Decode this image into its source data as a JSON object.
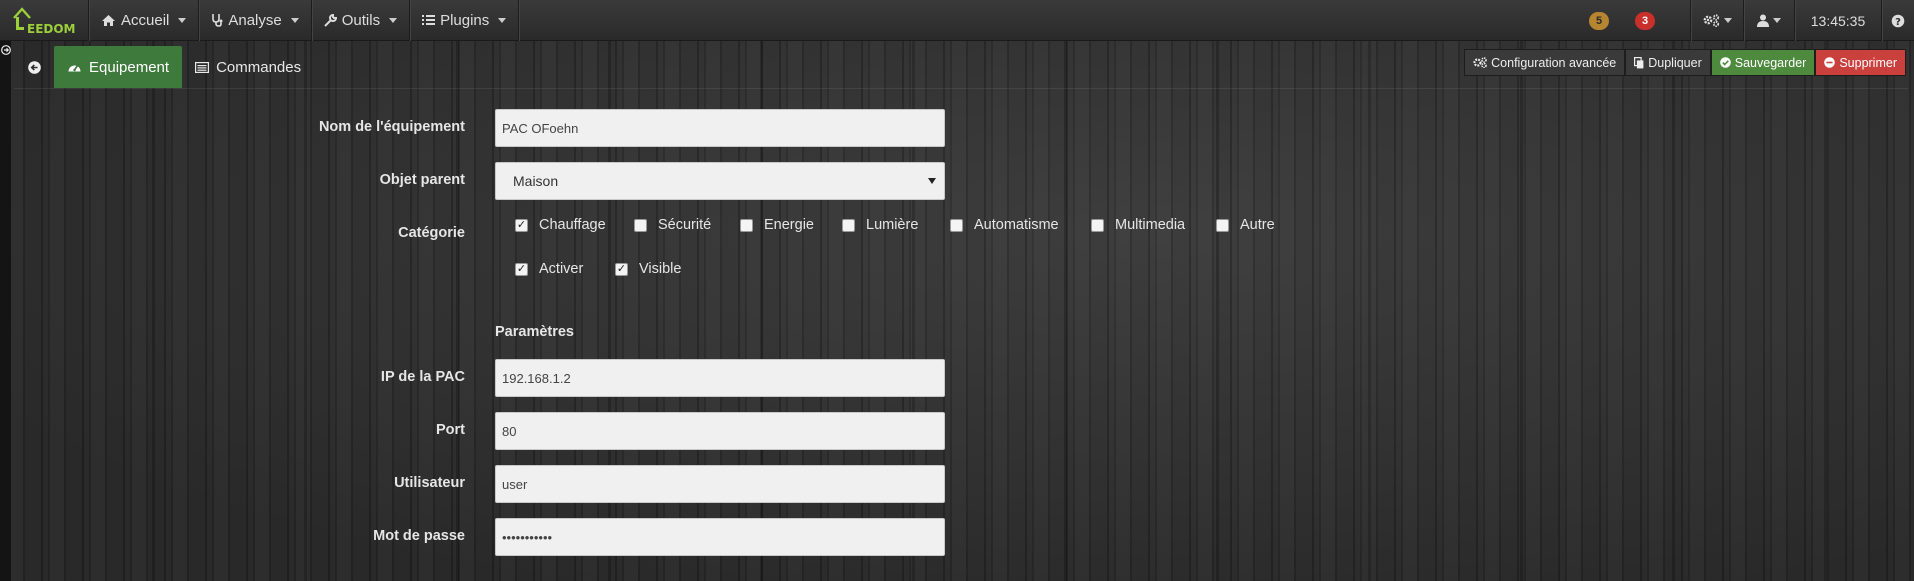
{
  "navbar": {
    "logo_text": "EEDOM",
    "menus": [
      {
        "label": "Accueil",
        "icon": "home-icon"
      },
      {
        "label": "Analyse",
        "icon": "stethoscope-icon"
      },
      {
        "label": "Outils",
        "icon": "wrench-icon"
      },
      {
        "label": "Plugins",
        "icon": "tasks-icon"
      }
    ],
    "badge_warning": "5",
    "badge_danger": "3",
    "clock": "13:45:35",
    "colors": {
      "warning": "#b5852f",
      "danger": "#c8302c",
      "brand": "#9ccf3a"
    }
  },
  "tabs": {
    "equipment": "Equipement",
    "commands": "Commandes"
  },
  "actions": {
    "advanced_config": "Configuration avancée",
    "duplicate": "Dupliquer",
    "save": "Sauvegarder",
    "delete": "Supprimer"
  },
  "form": {
    "name_label": "Nom de l'équipement",
    "name_value": "PAC OFoehn",
    "parent_label": "Objet parent",
    "parent_value": "Maison",
    "category_label": "Catégorie",
    "categories": [
      {
        "label": "Chauffage",
        "checked": true
      },
      {
        "label": "Sécurité",
        "checked": false
      },
      {
        "label": "Energie",
        "checked": false
      },
      {
        "label": "Lumière",
        "checked": false
      },
      {
        "label": "Automatisme",
        "checked": false
      },
      {
        "label": "Multimedia",
        "checked": false
      },
      {
        "label": "Autre",
        "checked": false
      }
    ],
    "status": [
      {
        "label": "Activer",
        "checked": true
      },
      {
        "label": "Visible",
        "checked": true
      }
    ],
    "params_title": "Paramètres",
    "ip_label": "IP de la PAC",
    "ip_value": "192.168.1.2",
    "port_label": "Port",
    "port_value": "80",
    "user_label": "Utilisateur",
    "user_value": "user",
    "password_label": "Mot de passe",
    "password_value": "•••••••••••"
  }
}
